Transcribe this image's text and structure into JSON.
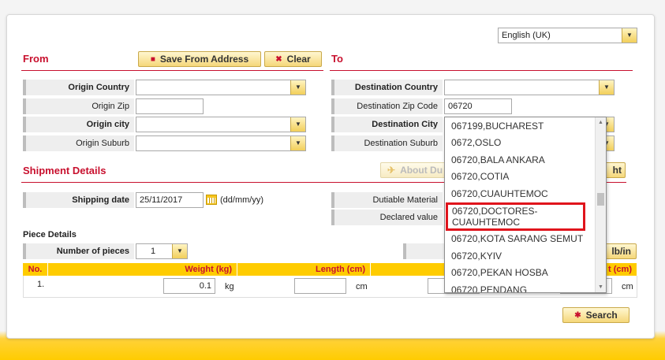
{
  "language": {
    "selected": "English (UK)"
  },
  "from": {
    "title": "From",
    "save_button": "Save From Address",
    "clear_button": "Clear",
    "origin_country_label": "Origin Country",
    "origin_country_value": "",
    "origin_zip_label": "Origin Zip",
    "origin_zip_value": "",
    "origin_city_label": "Origin city",
    "origin_city_value": "",
    "origin_suburb_label": "Origin Suburb",
    "origin_suburb_value": ""
  },
  "to": {
    "title": "To",
    "destination_country_label": "Destination Country",
    "destination_country_value": "",
    "destination_zip_label": "Destination Zip Code",
    "destination_zip_value": "06720",
    "destination_city_label": "Destination City",
    "destination_suburb_label": "Destination Suburb"
  },
  "shipment": {
    "title": "Shipment Details",
    "about_button": "About Du",
    "right_button_partial": "ht",
    "shipping_date_label": "Shipping date",
    "shipping_date_value": "25/11/2017",
    "date_format": "(dd/mm/yy)",
    "dutiable_label": "Dutiable Material",
    "declared_label": "Declared value"
  },
  "pieces": {
    "title": "Piece Details",
    "number_label": "Number of pieces",
    "number_value": "1",
    "unit_button_partial": "lb/in",
    "headers": {
      "no": "No.",
      "weight": "Weight (kg)",
      "length": "Length (cm)",
      "height_partial": "t (cm)"
    },
    "row": {
      "no": "1.",
      "weight": "0.1",
      "weight_unit": "kg",
      "length": "",
      "length_unit": "cm",
      "height_unit": "cm"
    }
  },
  "search_button": "Search",
  "suggestions": [
    "067199,BUCHAREST",
    "0672,OSLO",
    "06720,BALA ANKARA",
    "06720,COTIA",
    "06720,CUAUHTEMOC",
    "06720,DOCTORES-CUAUHTEMOC",
    "06720,KOTA SARANG SEMUT",
    "06720,KYIV",
    "06720,PEKAN HOSBA",
    "06720,PENDANG"
  ]
}
